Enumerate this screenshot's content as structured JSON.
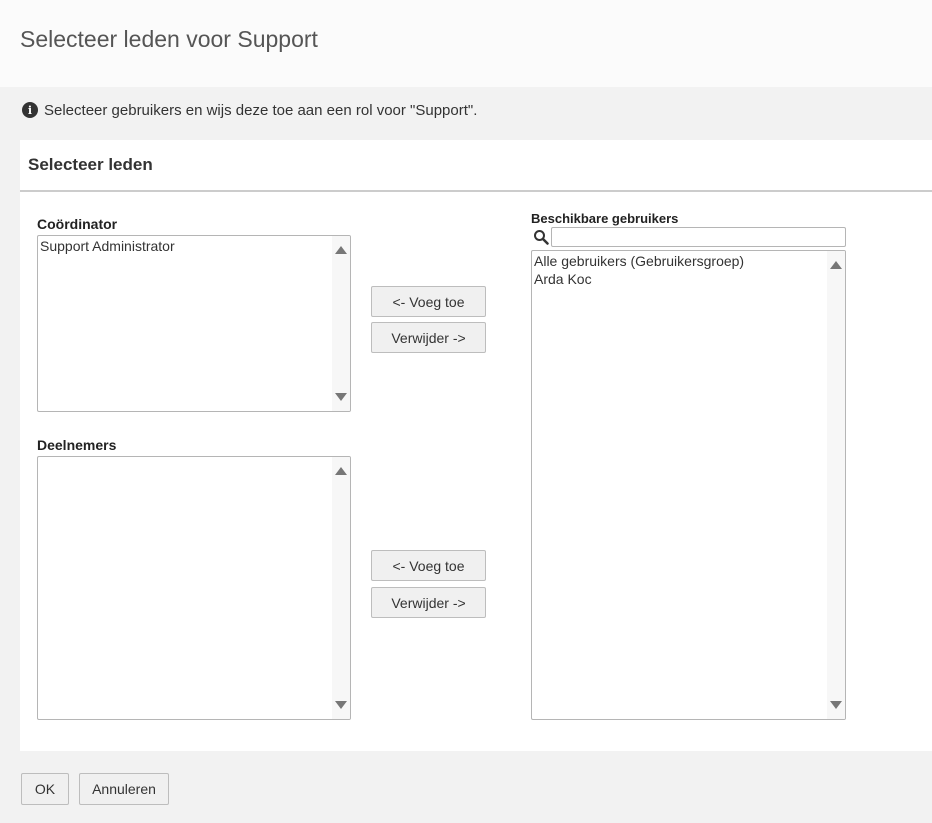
{
  "dialog": {
    "title": "Selecteer leden voor Support",
    "info_text": "Selecteer gebruikers en wijs deze toe aan een rol voor \"Support\"."
  },
  "panel": {
    "title": "Selecteer leden"
  },
  "coordinator": {
    "label": "Coördinator",
    "items": [
      "Support Administrator"
    ]
  },
  "participants": {
    "label": "Deelnemers",
    "items": []
  },
  "available": {
    "label": "Beschikbare gebruikers",
    "search_value": "",
    "items": [
      "Alle gebruikers (Gebruikersgroep)",
      "Arda Koc"
    ]
  },
  "buttons": {
    "add": "<- Voeg toe",
    "remove": "Verwijder ->",
    "ok": "OK",
    "cancel": "Annuleren"
  },
  "icons": {
    "info": "info-icon",
    "search": "search-icon"
  }
}
